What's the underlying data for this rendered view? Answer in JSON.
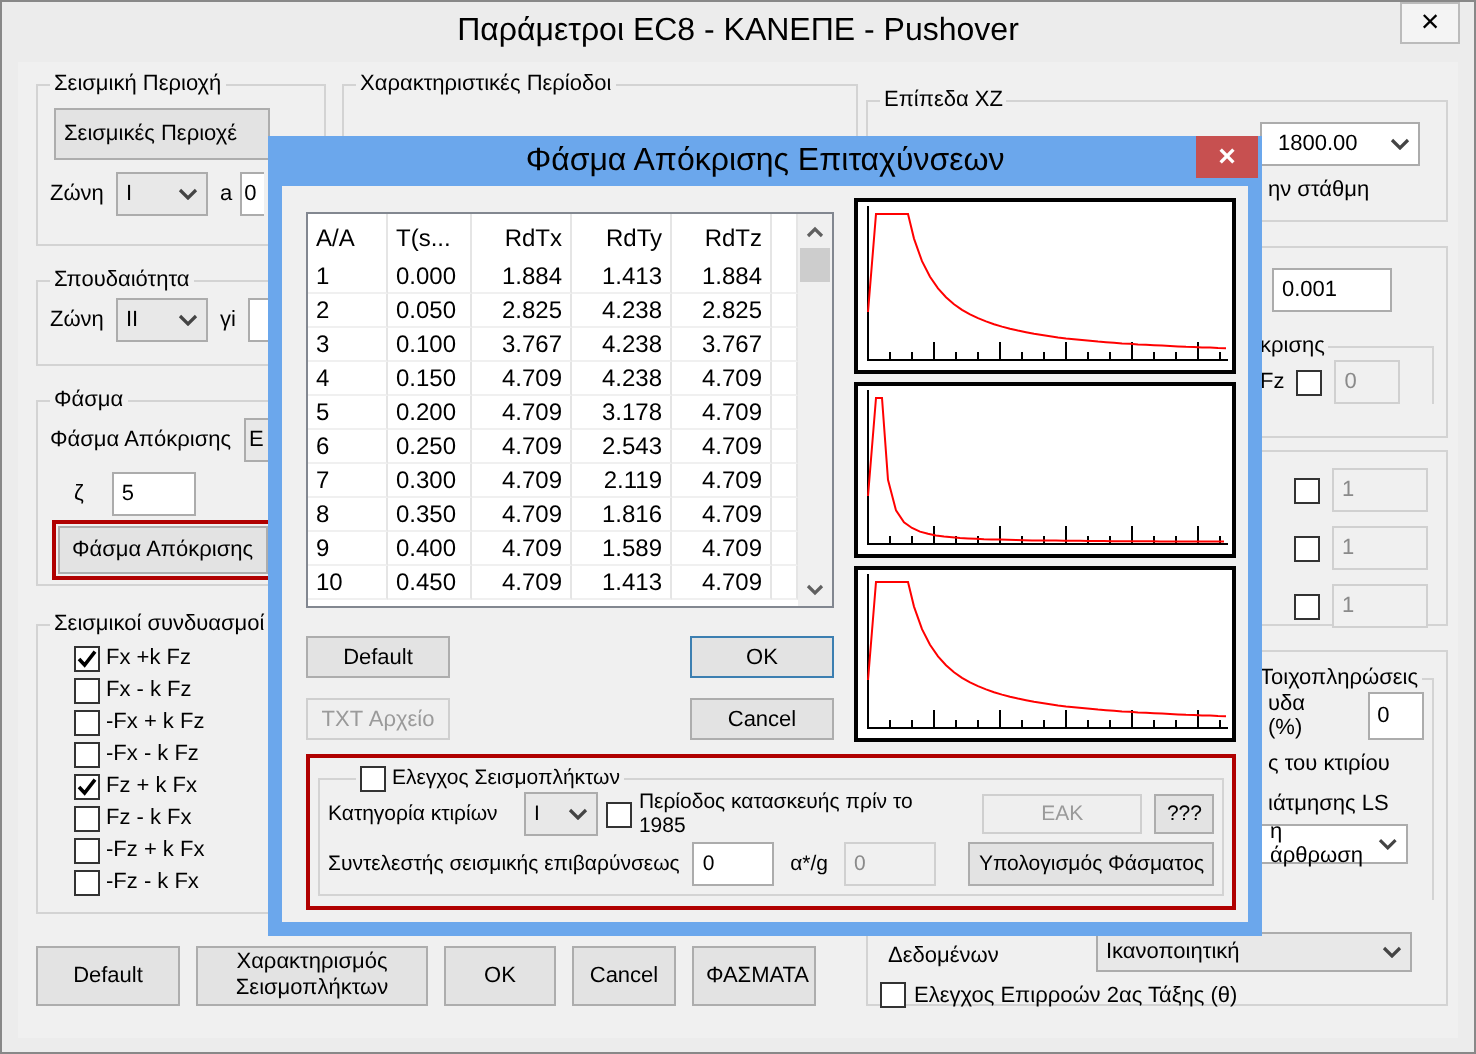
{
  "window": {
    "title": "Παράμετροι EC8 - ΚΑΝΕΠΕ - Pushover",
    "close": "×"
  },
  "seismic_zone": {
    "legend": "Σεισμική Περιοχή",
    "button": "Σεισμικές Περιοχέ",
    "zone_label": "Ζώνη",
    "zone": "I",
    "a_label": "a",
    "a_value": "0"
  },
  "importance": {
    "legend": "Σπουδαιότητα",
    "zone_label": "Ζώνη",
    "zone": "II",
    "gamma_label": "γi"
  },
  "spectrum": {
    "legend": "Φάσμα",
    "type_label": "Φάσμα Απόκρισης",
    "type_value": "Ε",
    "zeta_label": "ζ",
    "zeta_value": "5",
    "button": "Φάσμα Απόκρισης"
  },
  "combinations": {
    "legend": "Σεισμικοί συνδυασμοί",
    "items": [
      {
        "label": "Fx +k Fz",
        "checked": true
      },
      {
        "label": "Fx - k Fz",
        "checked": false
      },
      {
        "label": "-Fx + k Fz",
        "checked": false
      },
      {
        "label": "-Fx - k Fz",
        "checked": false
      },
      {
        "label": "Fz + k Fx",
        "checked": true
      },
      {
        "label": "Fz - k Fx",
        "checked": false
      },
      {
        "label": "-Fz + k Fx",
        "checked": false
      },
      {
        "label": "-Fz - k Fx",
        "checked": false
      }
    ]
  },
  "periods": {
    "legend": "Χαρακτηριστικές Περίοδοι"
  },
  "buttons": [
    {
      "label": "Default"
    },
    {
      "label": "Χαρακτηρισμός Σεισμοπλήκτων"
    },
    {
      "label": "OK"
    },
    {
      "label": "Cancel"
    },
    {
      "label": "ΦΑΣΜΑΤΑ"
    }
  ],
  "levels_xz": {
    "legend": "Επίπεδα XZ",
    "upper": "1800.00",
    "note": "ην στάθμη"
  },
  "right_panel": {
    "tolerance": "0.001",
    "spectrum_legend": "κρισης",
    "fz_label": "Fz",
    "fz_checked": false,
    "fz_value": "0",
    "factors": [
      {
        "checked": false,
        "value": "1"
      },
      {
        "checked": false,
        "value": "1"
      },
      {
        "checked": false,
        "value": "1"
      }
    ],
    "infill_legend": "Τοιχοπληρώσεις",
    "infill_label": "υδα (%)",
    "infill_value": "0",
    "text_1": "ς του κτιρίου",
    "text_2": "ιάτμησης LS",
    "hinge": "η άρθρωση",
    "reliability_label": "Δεδομένων",
    "reliability": "Ικανοποιητική",
    "second_order": {
      "label": "Ελεγχος Επιρροών 2ας Τάξης (θ)",
      "checked": false
    }
  },
  "dialog": {
    "title": "Φάσμα Απόκρισης Επιταχύνσεων",
    "close": "×",
    "table": {
      "columns": [
        "A/A",
        "T(s...",
        "RdTx",
        "RdTy",
        "RdTz"
      ],
      "rows": [
        [
          "1",
          "0.000",
          "1.884",
          "1.413",
          "1.884"
        ],
        [
          "2",
          "0.050",
          "2.825",
          "4.238",
          "2.825"
        ],
        [
          "3",
          "0.100",
          "3.767",
          "4.238",
          "3.767"
        ],
        [
          "4",
          "0.150",
          "4.709",
          "4.238",
          "4.709"
        ],
        [
          "5",
          "0.200",
          "4.709",
          "3.178",
          "4.709"
        ],
        [
          "6",
          "0.250",
          "4.709",
          "2.543",
          "4.709"
        ],
        [
          "7",
          "0.300",
          "4.709",
          "2.119",
          "4.709"
        ],
        [
          "8",
          "0.350",
          "4.709",
          "1.816",
          "4.709"
        ],
        [
          "9",
          "0.400",
          "4.709",
          "1.589",
          "4.709"
        ],
        [
          "10",
          "0.450",
          "4.709",
          "1.413",
          "4.709"
        ]
      ]
    },
    "buttons": [
      {
        "label": "Default",
        "disabled": false,
        "focused": false
      },
      {
        "label": "OK",
        "disabled": false,
        "focused": true
      },
      {
        "label": "TXT Αρχείο",
        "disabled": true,
        "focused": false
      },
      {
        "label": "Cancel",
        "disabled": false,
        "focused": false
      }
    ],
    "damaged": {
      "label": "Ελεγχος Σεισμοπλήκτων",
      "checked": false,
      "category_label": "Κατηγορία κτιρίων",
      "category": "I",
      "period": {
        "label": "Περίοδος κατασκευής πρίν το 1985",
        "checked": false
      },
      "eak_button": {
        "label": "ΕΑΚ",
        "disabled": true
      },
      "help_button": {
        "label": "???",
        "disabled": false
      },
      "factor_label": "Συντελεστής σεισμικής επιβαρύνσεως",
      "factor_value": "0",
      "ratio_label": "α*/g",
      "ratio_value": "0",
      "compute_button": {
        "label": "Υπολογισμός Φάσματος",
        "disabled": false
      }
    }
  }
}
